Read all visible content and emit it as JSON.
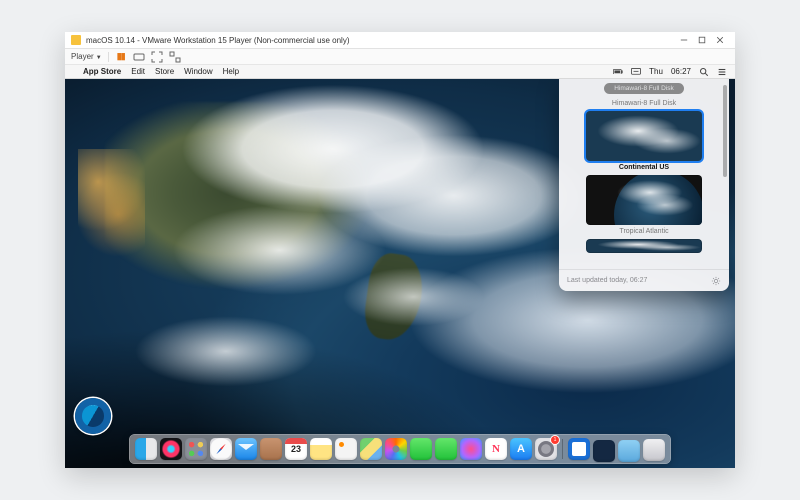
{
  "host_window": {
    "title": "macOS 10.14 - VMware Workstation 15 Player (Non-commercial use only)",
    "controls": {
      "minimize": "Minimize",
      "maximize": "Maximize",
      "close": "Close"
    }
  },
  "vm_toolbar": {
    "player_menu": "Player",
    "buttons": {
      "pause": "Pause VM",
      "send_cad": "Send Ctrl+Alt+Del",
      "fullscreen": "Enter Full Screen",
      "unity": "Enter Unity"
    }
  },
  "mac_menubar": {
    "app": "App Store",
    "items": [
      "Edit",
      "Store",
      "Window",
      "Help"
    ],
    "right": {
      "battery": "Battery",
      "control": "Control Strip",
      "day": "Thu",
      "time": "06:27",
      "search": "Spotlight Search",
      "notifications": "Notification Center"
    }
  },
  "wallpaper": {
    "source_badge": "NOAA"
  },
  "popover": {
    "header_pill": "Himawari-8 Full Disk",
    "options": [
      {
        "label": "Himawari-8 Full Disk",
        "selected": false
      },
      {
        "label": "Continental US",
        "selected": true
      },
      {
        "label": "Tropical Atlantic",
        "selected": false
      }
    ],
    "footer": "Last updated today, 06:27",
    "settings": "Preferences"
  },
  "dock": {
    "calendar_day": "23",
    "sysprefs_badge": "1",
    "items": [
      {
        "name": "finder",
        "label": "Finder"
      },
      {
        "name": "siri",
        "label": "Siri"
      },
      {
        "name": "launchpad",
        "label": "Launchpad"
      },
      {
        "name": "safari",
        "label": "Safari"
      },
      {
        "name": "mail",
        "label": "Mail"
      },
      {
        "name": "contacts",
        "label": "Contacts"
      },
      {
        "name": "calendar",
        "label": "Calendar"
      },
      {
        "name": "notes",
        "label": "Notes"
      },
      {
        "name": "reminders",
        "label": "Reminders"
      },
      {
        "name": "maps",
        "label": "Maps"
      },
      {
        "name": "photos",
        "label": "Photos"
      },
      {
        "name": "messages",
        "label": "Messages"
      },
      {
        "name": "facetime",
        "label": "FaceTime"
      },
      {
        "name": "itunes",
        "label": "iTunes"
      },
      {
        "name": "news",
        "label": "News"
      },
      {
        "name": "appstore",
        "label": "App Store"
      },
      {
        "name": "sysprefs",
        "label": "System Preferences"
      },
      {
        "name": "generic-app",
        "label": "Application"
      },
      {
        "name": "downloads",
        "label": "Downloads"
      },
      {
        "name": "folder",
        "label": "Folder"
      },
      {
        "name": "trash",
        "label": "Trash"
      }
    ]
  }
}
